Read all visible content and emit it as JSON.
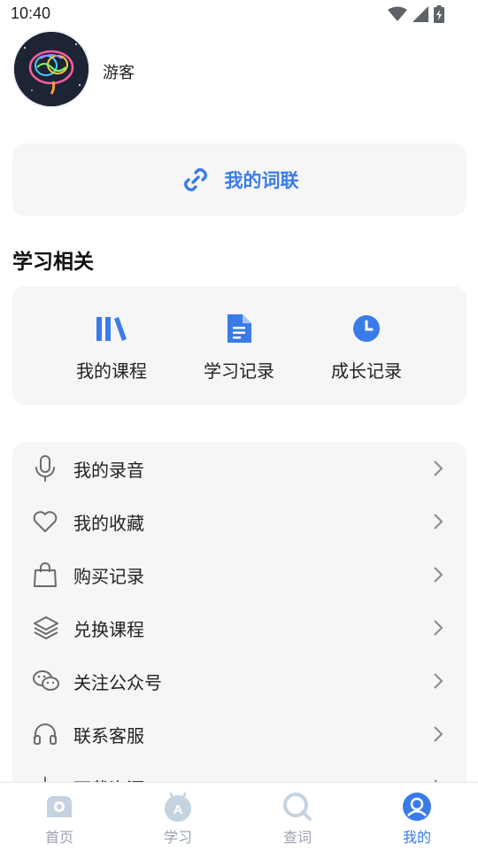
{
  "status_bar": {
    "time": "10:40"
  },
  "profile": {
    "username": "游客"
  },
  "link_card": {
    "label": "我的词联"
  },
  "study_section": {
    "title": "学习相关",
    "items": [
      {
        "label": "我的课程",
        "icon": "books-icon"
      },
      {
        "label": "学习记录",
        "icon": "document-icon"
      },
      {
        "label": "成长记录",
        "icon": "clock-icon"
      }
    ]
  },
  "menu": {
    "items": [
      {
        "label": "我的录音",
        "icon": "microphone-icon"
      },
      {
        "label": "我的收藏",
        "icon": "heart-icon"
      },
      {
        "label": "购买记录",
        "icon": "shopping-bag-icon"
      },
      {
        "label": "兑换课程",
        "icon": "layers-icon"
      },
      {
        "label": "关注公众号",
        "icon": "wechat-icon"
      },
      {
        "label": "联系客服",
        "icon": "headset-icon"
      },
      {
        "label": "下载资源",
        "icon": "download-icon"
      }
    ]
  },
  "bottom_nav": {
    "items": [
      {
        "label": "首页",
        "icon": "home-icon"
      },
      {
        "label": "学习",
        "icon": "study-icon"
      },
      {
        "label": "查词",
        "icon": "search-icon"
      },
      {
        "label": "我的",
        "icon": "profile-icon",
        "active": true
      }
    ]
  },
  "colors": {
    "accent": "#3a7bea",
    "card_bg": "#f6f6f7",
    "inactive": "#9aa3b0"
  }
}
